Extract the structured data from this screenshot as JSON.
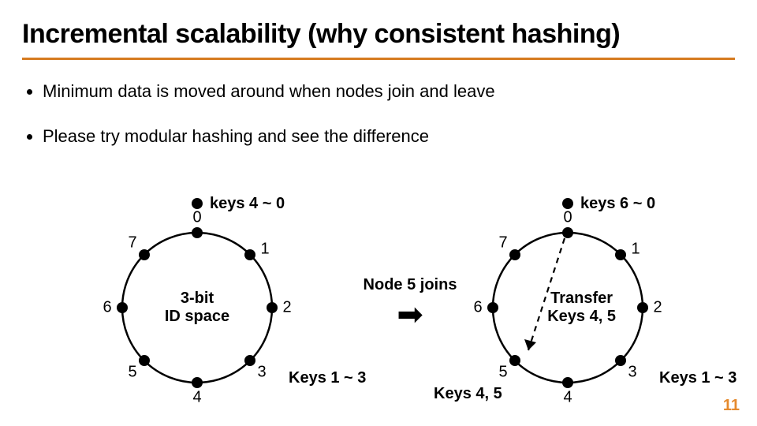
{
  "title": "Incremental scalability (why consistent hashing)",
  "bullets": [
    "Minimum data is moved around when nodes join and leave",
    "Please try modular hashing and see the difference"
  ],
  "ring_nodes": [
    "0",
    "1",
    "2",
    "3",
    "4",
    "5",
    "6",
    "7"
  ],
  "left": {
    "top_caption": "keys 4 ~ 0",
    "center": "3-bit\nID space",
    "side_caption": "Keys 1 ~ 3"
  },
  "right": {
    "top_caption": "keys 6 ~ 0",
    "center": "Transfer\nKeys 4, 5",
    "side_caption": "Keys 1 ~ 3",
    "bottom_caption": "Keys 4, 5"
  },
  "middle_caption": "Node 5 joins",
  "arrow_glyph": "➡",
  "page_number": "11",
  "chart_data": {
    "type": "diagram",
    "title": "Consistent hashing ring before and after a node joins",
    "id_space_bits": 3,
    "positions": [
      0,
      1,
      2,
      3,
      4,
      5,
      6,
      7
    ],
    "before": {
      "active_nodes": [
        0,
        3
      ],
      "key_ownership": {
        "0": "keys 4 ~ 0",
        "3": "Keys 1 ~ 3"
      }
    },
    "event": "Node 5 joins",
    "after": {
      "active_nodes": [
        0,
        3,
        5
      ],
      "key_ownership": {
        "0": "keys 6 ~ 0",
        "3": "Keys 1 ~ 3",
        "5": "Keys 4, 5"
      },
      "keys_transferred_to_5": [
        4,
        5
      ]
    }
  }
}
